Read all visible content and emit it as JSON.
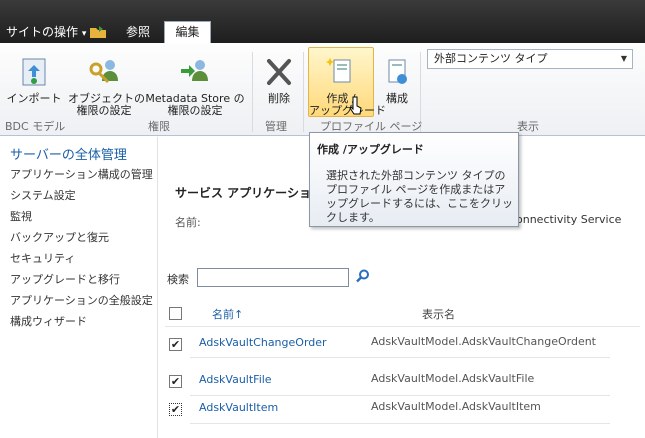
{
  "topbar": {
    "site_actions": "サイトの操作",
    "site_actions_arrow": "▾",
    "browse": "参照",
    "edit": "編集"
  },
  "ribbon": {
    "import": "インポート",
    "object_perm": [
      "オブジェクトの",
      "権限の設定"
    ],
    "store_perm": [
      "Metadata Store の",
      "権限の設定"
    ],
    "delete": "削除",
    "create_upgrade": [
      "作成 /",
      "アップグレード"
    ],
    "configure": "構成",
    "dropdown": "外部コンテンツ タイプ",
    "groups": {
      "bdc": "BDC モデル",
      "perm": "権限",
      "manage": "管理",
      "profile": "プロファイル ページ",
      "view": "表示"
    }
  },
  "nav": {
    "title": "サーバーの全体管理",
    "items": [
      "アプリケーション構成の管理",
      "システム設定",
      "監視",
      "バックアップと復元",
      "セキュリティ",
      "アップグレードと移行",
      "アプリケーションの全般設定",
      "構成ウィザード"
    ]
  },
  "tooltip": {
    "title": "作成 /アップグレード",
    "body": "選択された外部コンテンツ タイプのプロファイル ページを作成またはアップグレードするには、ここをクリックします。"
  },
  "main": {
    "heading": "サービス アプリケーションの",
    "name_label": "名前:",
    "name_value": "onnectivity Service",
    "search_label": "検索",
    "col_name": "名前↑",
    "col_display": "表示名",
    "rows": [
      {
        "name": "AdskVaultChangeOrder",
        "display": "AdskVaultModel.AdskVaultChangeOrdent",
        "checked": "✔"
      },
      {
        "name": "AdskVaultFile",
        "display": "AdskVaultModel.AdskVaultFile",
        "checked": "✔"
      },
      {
        "name": "AdskVaultItem",
        "display": "AdskVaultModel.AdskVaultItem",
        "checked": "✔"
      }
    ]
  }
}
